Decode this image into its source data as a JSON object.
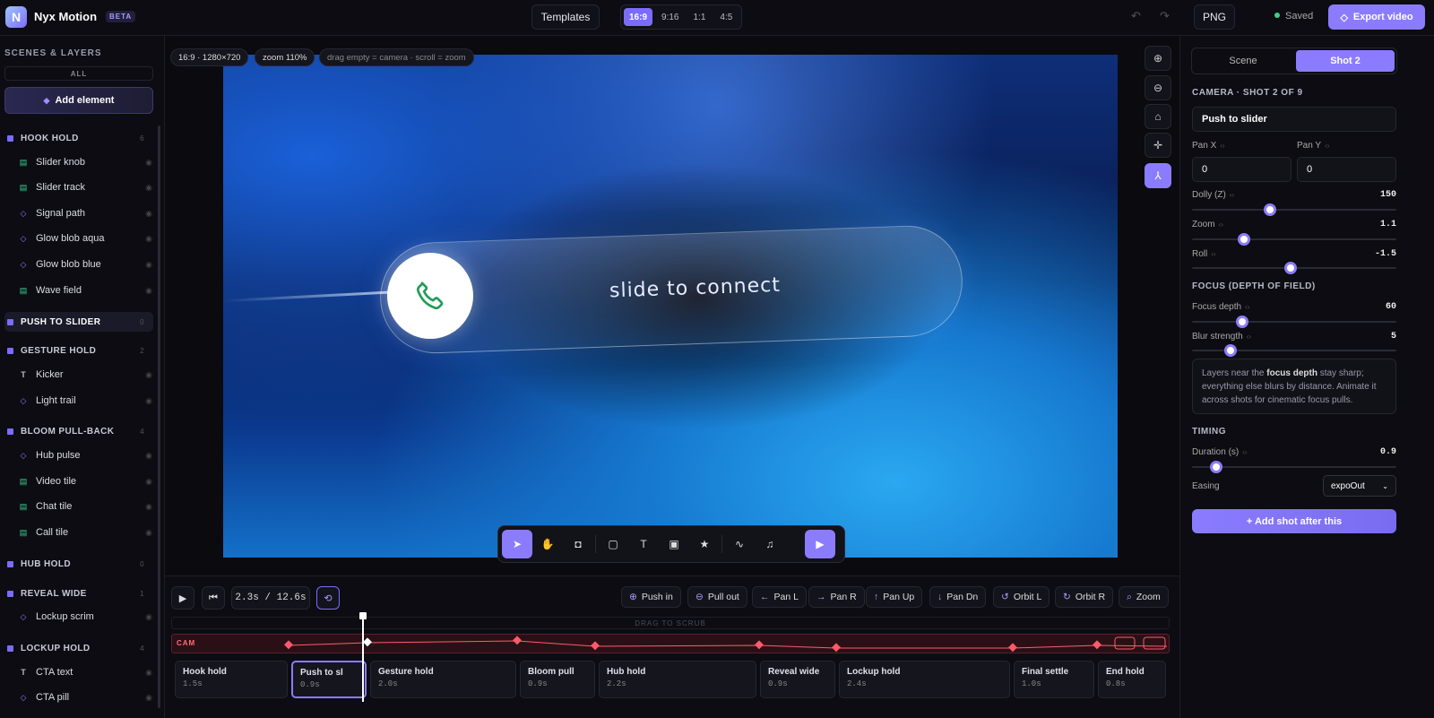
{
  "app": {
    "name": "Nyx Motion",
    "logo_letter": "N",
    "beta": "BETA"
  },
  "topbar": {
    "templates": "Templates",
    "ratios": [
      {
        "label": "16:9",
        "active": true
      },
      {
        "label": "9:16",
        "active": false
      },
      {
        "label": "1:1",
        "active": false
      },
      {
        "label": "4:5",
        "active": false
      }
    ],
    "png": "PNG",
    "saved": "Saved",
    "export": "Export video"
  },
  "left": {
    "header": "SCENES & LAYERS",
    "all": "ALL",
    "add_element": "Add element",
    "groups": [
      {
        "label": "HOOK HOLD",
        "count": "6",
        "layers": [
          {
            "label": "Slider knob",
            "icon": "image-layer-icon"
          },
          {
            "label": "Slider track",
            "icon": "image-layer-icon"
          },
          {
            "label": "Signal path",
            "icon": "shape-layer-icon"
          },
          {
            "label": "Glow blob aqua",
            "icon": "shape-layer-icon"
          },
          {
            "label": "Glow blob blue",
            "icon": "shape-layer-icon"
          },
          {
            "label": "Wave field",
            "icon": "image-layer-icon"
          }
        ]
      },
      {
        "label": "PUSH TO SLIDER",
        "count": "0",
        "selected": true,
        "layers": []
      },
      {
        "label": "GESTURE HOLD",
        "count": "2",
        "layers": [
          {
            "label": "Kicker",
            "icon": "text-layer-icon"
          },
          {
            "label": "Light trail",
            "icon": "shape-layer-icon"
          }
        ]
      },
      {
        "label": "BLOOM PULL-BACK",
        "count": "4",
        "layers": [
          {
            "label": "Hub pulse",
            "icon": "shape-layer-icon"
          },
          {
            "label": "Video tile",
            "icon": "image-layer-icon"
          },
          {
            "label": "Chat tile",
            "icon": "image-layer-icon"
          },
          {
            "label": "Call tile",
            "icon": "image-layer-icon"
          }
        ]
      },
      {
        "label": "HUB HOLD",
        "count": "0",
        "layers": []
      },
      {
        "label": "REVEAL WIDE",
        "count": "1",
        "layers": [
          {
            "label": "Lockup scrim",
            "icon": "shape-layer-icon"
          }
        ]
      },
      {
        "label": "LOCKUP HOLD",
        "count": "4",
        "layers": [
          {
            "label": "CTA text",
            "icon": "text-layer-icon"
          },
          {
            "label": "CTA pill",
            "icon": "shape-layer-icon"
          }
        ]
      }
    ]
  },
  "stage": {
    "info_size": "16:9 · 1280×720",
    "info_zoom": "zoom 110%",
    "info_hint": "drag empty = camera · scroll = zoom",
    "slider_text": "slide to connect"
  },
  "timeline": {
    "time": "2.3s / 12.6s",
    "camera_buttons": [
      {
        "icon": "⊕",
        "label": "Push in"
      },
      {
        "icon": "⊖",
        "label": "Pull out"
      },
      {
        "icon": "←",
        "label": "Pan L"
      },
      {
        "icon": "→",
        "label": "Pan R"
      },
      {
        "icon": "↑",
        "label": "Pan Up"
      },
      {
        "icon": "↓",
        "label": "Pan Dn"
      },
      {
        "icon": "↺",
        "label": "Orbit L"
      },
      {
        "icon": "↻",
        "label": "Orbit R"
      },
      {
        "icon": "⌕",
        "label": "Zoom"
      }
    ],
    "scrub_label": "DRAG TO SCRUB",
    "cam_label": "CAM",
    "shots": [
      {
        "name": "Hook hold",
        "dur": "1.5s"
      },
      {
        "name": "Push to sl",
        "dur": "0.9s",
        "selected": true
      },
      {
        "name": "Gesture hold",
        "dur": "2.0s"
      },
      {
        "name": "Bloom pull",
        "dur": "0.9s"
      },
      {
        "name": "Hub hold",
        "dur": "2.2s"
      },
      {
        "name": "Reveal wide",
        "dur": "0.9s"
      },
      {
        "name": "Lockup hold",
        "dur": "2.4s"
      },
      {
        "name": "Final settle",
        "dur": "1.0s"
      },
      {
        "name": "End hold",
        "dur": "0.8s"
      }
    ]
  },
  "right": {
    "tab_scene": "Scene",
    "tab_shot": "Shot 2",
    "camera_header": "CAMERA · SHOT 2 OF 9",
    "shot_name": "Push to slider",
    "pan_x_label": "Pan X",
    "pan_y_label": "Pan Y",
    "pan_x": "0",
    "pan_y": "0",
    "dolly_label": "Dolly (Z)",
    "dolly": "150",
    "zoom_label": "Zoom",
    "zoom": "1.1",
    "roll_label": "Roll",
    "roll": "-1.5",
    "focus_header": "FOCUS (DEPTH OF FIELD)",
    "focus_depth_label": "Focus depth",
    "focus_depth": "60",
    "blur_label": "Blur strength",
    "blur": "5",
    "note_pre": "Layers near the ",
    "note_bold": "focus depth",
    "note_post": " stay sharp; everything else blurs by distance. Animate it across shots for cinematic focus pulls.",
    "timing_header": "TIMING",
    "duration_label": "Duration (s)",
    "duration": "0.9",
    "easing_label": "Easing",
    "easing": "expoOut",
    "add_shot": "+ Add shot after this"
  }
}
